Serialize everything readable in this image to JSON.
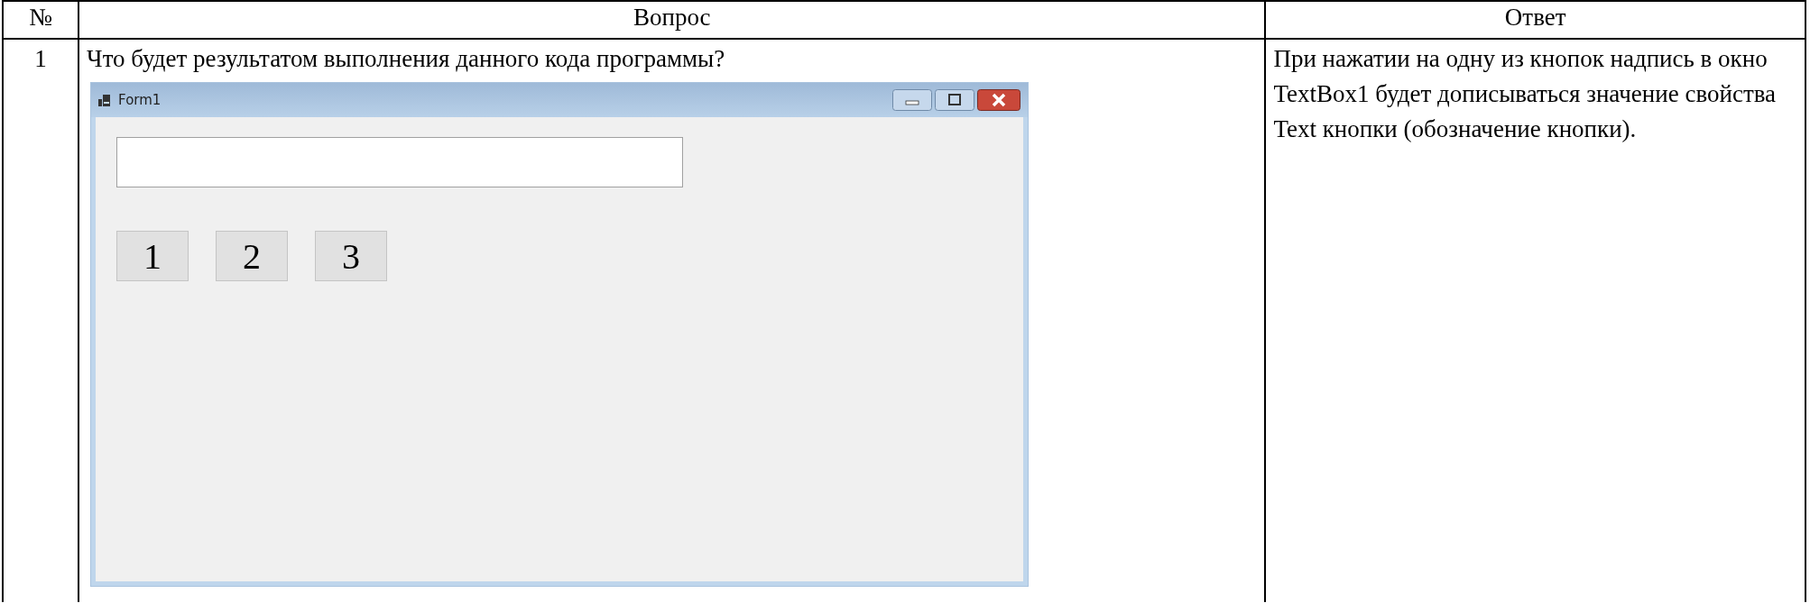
{
  "table": {
    "columns": [
      "№",
      "Вопрос",
      "Ответ"
    ],
    "rows": [
      {
        "number": "1",
        "question": "Что будет результатом выполнения данного кода программы?",
        "answer": "При нажатии на одну из кнопок надпись в окно TextBox1 будет дописываться значение свойства Text кнопки (обозначение кнопки).",
        "form_window": {
          "title": "Form1",
          "buttons": [
            "1",
            "2",
            "3"
          ]
        }
      }
    ]
  }
}
